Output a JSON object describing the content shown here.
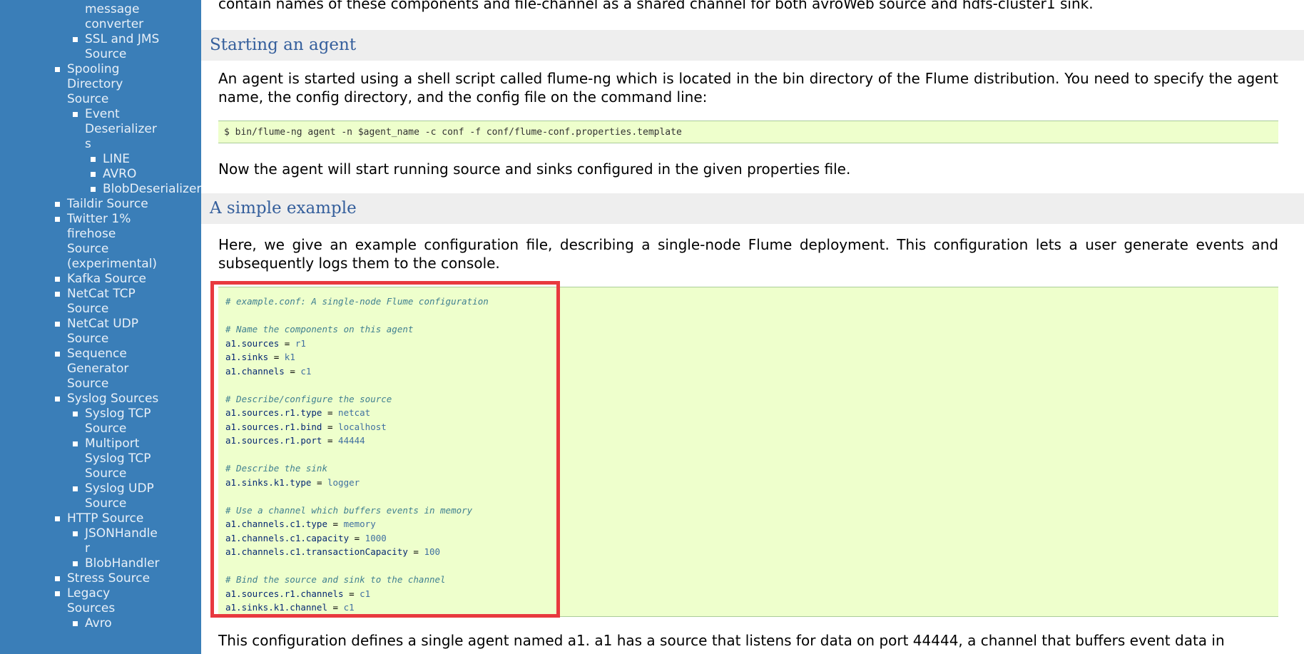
{
  "sidebar": {
    "items": [
      {
        "level": 2,
        "label": "message converter",
        "bullet": false
      },
      {
        "level": 2,
        "label": "SSL and JMS Source",
        "bullet": true
      },
      {
        "level": 1,
        "label": "Spooling Directory Source",
        "bullet": true
      },
      {
        "level": 2,
        "label": "Event Deserializers",
        "bullet": true
      },
      {
        "level": 3,
        "label": "LINE",
        "bullet": true
      },
      {
        "level": 3,
        "label": "AVRO",
        "bullet": true
      },
      {
        "level": 3,
        "label": "BlobDeserializer",
        "bullet": true
      },
      {
        "level": 1,
        "label": "Taildir Source",
        "bullet": true
      },
      {
        "level": 1,
        "label": "Twitter 1% firehose Source (experimental)",
        "bullet": true
      },
      {
        "level": 1,
        "label": "Kafka Source",
        "bullet": true
      },
      {
        "level": 1,
        "label": "NetCat TCP Source",
        "bullet": true
      },
      {
        "level": 1,
        "label": "NetCat UDP Source",
        "bullet": true
      },
      {
        "level": 1,
        "label": "Sequence Generator Source",
        "bullet": true
      },
      {
        "level": 1,
        "label": "Syslog Sources",
        "bullet": true
      },
      {
        "level": 2,
        "label": "Syslog TCP Source",
        "bullet": true
      },
      {
        "level": 2,
        "label": "Multiport Syslog TCP Source",
        "bullet": true
      },
      {
        "level": 2,
        "label": "Syslog UDP Source",
        "bullet": true
      },
      {
        "level": 1,
        "label": "HTTP Source",
        "bullet": true
      },
      {
        "level": 2,
        "label": "JSONHandler",
        "bullet": true
      },
      {
        "level": 2,
        "label": "BlobHandler",
        "bullet": true
      },
      {
        "level": 1,
        "label": "Stress Source",
        "bullet": true
      },
      {
        "level": 1,
        "label": "Legacy Sources",
        "bullet": true
      },
      {
        "level": 2,
        "label": "Avro",
        "bullet": true
      }
    ]
  },
  "main": {
    "intro_tail": "contain names of these components and file-channel as a shared channel for both avroWeb source and hdfs-cluster1 sink.",
    "section_starting": {
      "title": "Starting an agent",
      "paragraph": "An agent is started using a shell script called flume-ng which is located in the bin directory of the Flume distribution. You need to specify the agent name, the config directory, and the config file on the command line:",
      "command": "$ bin/flume-ng agent -n $agent_name -c conf -f conf/flume-conf.properties.template",
      "after": "Now the agent will start running source and sinks configured in the given properties file."
    },
    "section_example": {
      "title": "A simple example",
      "paragraph": "Here, we give an example configuration file, describing a single-node Flume deployment. This configuration lets a user generate events and subsequently logs them to the console.",
      "code_lines": [
        {
          "type": "comment",
          "text": "# example.conf: A single-node Flume configuration"
        },
        {
          "type": "blank",
          "text": ""
        },
        {
          "type": "comment",
          "text": "# Name the components on this agent"
        },
        {
          "type": "kv",
          "key": "a1.sources",
          "value": "r1"
        },
        {
          "type": "kv",
          "key": "a1.sinks",
          "value": "k1"
        },
        {
          "type": "kv",
          "key": "a1.channels",
          "value": "c1"
        },
        {
          "type": "blank",
          "text": ""
        },
        {
          "type": "comment",
          "text": "# Describe/configure the source"
        },
        {
          "type": "kv",
          "key": "a1.sources.r1.type",
          "value": "netcat"
        },
        {
          "type": "kv",
          "key": "a1.sources.r1.bind",
          "value": "localhost"
        },
        {
          "type": "kv",
          "key": "a1.sources.r1.port",
          "value": "44444"
        },
        {
          "type": "blank",
          "text": ""
        },
        {
          "type": "comment",
          "text": "# Describe the sink"
        },
        {
          "type": "kv",
          "key": "a1.sinks.k1.type",
          "value": "logger"
        },
        {
          "type": "blank",
          "text": ""
        },
        {
          "type": "comment",
          "text": "# Use a channel which buffers events in memory"
        },
        {
          "type": "kv",
          "key": "a1.channels.c1.type",
          "value": "memory"
        },
        {
          "type": "kv",
          "key": "a1.channels.c1.capacity",
          "value": "1000"
        },
        {
          "type": "kv",
          "key": "a1.channels.c1.transactionCapacity",
          "value": "100"
        },
        {
          "type": "blank",
          "text": ""
        },
        {
          "type": "comment",
          "text": "# Bind the source and sink to the channel"
        },
        {
          "type": "kv",
          "key": "a1.sources.r1.channels",
          "value": "c1"
        },
        {
          "type": "kv",
          "key": "a1.sinks.k1.channel",
          "value": "c1"
        }
      ],
      "after": "This configuration defines a single agent named a1. a1 has a source that listens for data on port 44444, a channel that buffers event data in"
    }
  },
  "colors": {
    "sidebar_bg": "#3a7eb8",
    "heading_text": "#355f9c",
    "code_bg": "#eeffcc",
    "highlight_border": "#e8393f"
  }
}
